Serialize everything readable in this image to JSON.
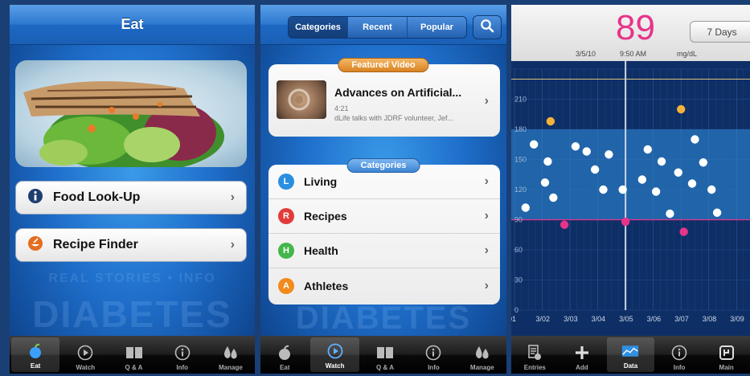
{
  "eat_screen": {
    "title": "Eat",
    "buttons": [
      {
        "label": "Food Look-Up",
        "icon": "info-icon"
      },
      {
        "label": "Recipe Finder",
        "icon": "recipe-icon"
      }
    ],
    "watermark_line1": "REAL STORIES • INFO",
    "watermark_line2": "DIABETES"
  },
  "watch_screen": {
    "segments": [
      "Categories",
      "Recent",
      "Popular"
    ],
    "selected_segment": "Categories",
    "featured_label": "Featured Video",
    "featured": {
      "title": "Advances on Artificial...",
      "duration": "4:21",
      "description": "dLife talks with JDRF volunteer, Jef..."
    },
    "categories_label": "Categories",
    "categories": [
      {
        "letter": "L",
        "label": "Living",
        "color": "#2b8fe0"
      },
      {
        "letter": "R",
        "label": "Recipes",
        "color": "#e23b3b"
      },
      {
        "letter": "H",
        "label": "Health",
        "color": "#43b649"
      },
      {
        "letter": "A",
        "label": "Athletes",
        "color": "#f28a1c"
      }
    ],
    "watermark": "DIABETES"
  },
  "tabbar_left": [
    {
      "label": "Eat",
      "icon": "apple-icon"
    },
    {
      "label": "Watch",
      "icon": "play-icon"
    },
    {
      "label": "Q & A",
      "icon": "book-icon"
    },
    {
      "label": "Info",
      "icon": "info-icon"
    },
    {
      "label": "Manage",
      "icon": "drops-icon"
    }
  ],
  "tabbar_right": [
    {
      "label": "Entries",
      "icon": "entries-icon"
    },
    {
      "label": "Add",
      "icon": "plus-icon"
    },
    {
      "label": "Data",
      "icon": "chart-icon"
    },
    {
      "label": "Info",
      "icon": "info-icon"
    },
    {
      "label": "Main",
      "icon": "main-icon"
    }
  ],
  "data_screen": {
    "reading": "89",
    "range_button": "7 Days",
    "date": "3/5/10",
    "time": "9:50 AM",
    "unit": "mg/dL",
    "colors": {
      "normal": "#ffffff",
      "high": "#f5b23a",
      "low": "#e7348a",
      "target_band": "#2f8fe0"
    }
  },
  "chart_data": {
    "type": "scatter",
    "x_tick_labels": [
      "01",
      "3/02",
      "3/03",
      "3/04",
      "3/05",
      "3/06",
      "3/07",
      "3/08",
      "3/09"
    ],
    "y_tick_labels": [
      "0",
      "30",
      "60",
      "90",
      "120",
      "150",
      "180",
      "210"
    ],
    "ylim": [
      0,
      240
    ],
    "xlim": [
      1,
      9.6
    ],
    "target_range": [
      90,
      180
    ],
    "selected_x": 5.0,
    "series": [
      {
        "points": [
          [
            1.4,
            102
          ],
          [
            1.7,
            165
          ],
          [
            2.1,
            127
          ],
          [
            2.2,
            148
          ],
          [
            2.4,
            112
          ],
          [
            3.2,
            163
          ],
          [
            3.6,
            158
          ],
          [
            3.9,
            140
          ],
          [
            4.2,
            120
          ],
          [
            4.4,
            155
          ],
          [
            4.9,
            120
          ],
          [
            5.6,
            130
          ],
          [
            5.8,
            160
          ],
          [
            6.1,
            118
          ],
          [
            6.3,
            148
          ],
          [
            6.6,
            96
          ],
          [
            6.9,
            137
          ],
          [
            7.5,
            170
          ],
          [
            7.4,
            126
          ],
          [
            7.8,
            147
          ],
          [
            8.1,
            120
          ],
          [
            8.3,
            97
          ]
        ]
      },
      {
        "points": [
          [
            2.3,
            188
          ],
          [
            7.0,
            200
          ]
        ]
      },
      {
        "points": [
          [
            2.8,
            85
          ],
          [
            5.0,
            88
          ],
          [
            7.1,
            78
          ]
        ]
      }
    ]
  }
}
